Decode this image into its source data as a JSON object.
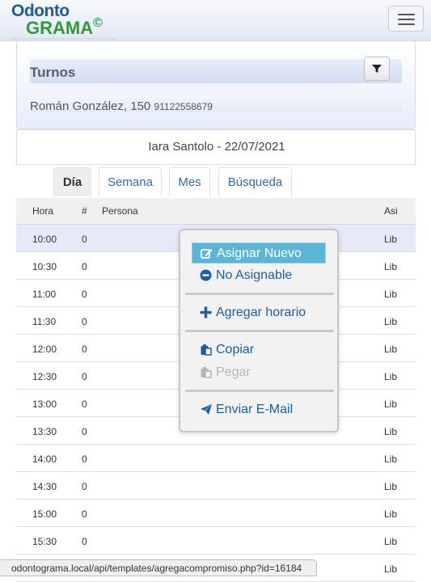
{
  "logo": {
    "line1": "Odonto",
    "line2": "GRAMA",
    "mark": "©"
  },
  "panel": {
    "title": "Turnos",
    "patient_name": "Román González, 150",
    "patient_phone": "91122558679"
  },
  "doctor_date": "Iara Santolo - 22/07/2021",
  "tabs": [
    {
      "label": "Día",
      "active": true
    },
    {
      "label": "Semana",
      "active": false
    },
    {
      "label": "Mes",
      "active": false
    },
    {
      "label": "Búsqueda",
      "active": false
    }
  ],
  "table": {
    "headers": {
      "hora": "Hora",
      "num": "#",
      "persona": "Persona",
      "asi": "Asi"
    },
    "rows": [
      {
        "hora": "10:00",
        "num": "0",
        "persona": "",
        "asi": "Lib"
      },
      {
        "hora": "10:30",
        "num": "0",
        "persona": "",
        "asi": "Lib"
      },
      {
        "hora": "11:00",
        "num": "0",
        "persona": "",
        "asi": "Lib"
      },
      {
        "hora": "11:30",
        "num": "0",
        "persona": "",
        "asi": "Lib"
      },
      {
        "hora": "12:00",
        "num": "0",
        "persona": "",
        "asi": "Lib"
      },
      {
        "hora": "12:30",
        "num": "0",
        "persona": "",
        "asi": "Lib"
      },
      {
        "hora": "13:00",
        "num": "0",
        "persona": "",
        "asi": "Lib"
      },
      {
        "hora": "13:30",
        "num": "0",
        "persona": "",
        "asi": "Lib"
      },
      {
        "hora": "14:00",
        "num": "0",
        "persona": "",
        "asi": "Lib"
      },
      {
        "hora": "14:30",
        "num": "0",
        "persona": "",
        "asi": "Lib"
      },
      {
        "hora": "15:00",
        "num": "0",
        "persona": "",
        "asi": "Lib"
      },
      {
        "hora": "15:30",
        "num": "0",
        "persona": "",
        "asi": "Lib"
      },
      {
        "hora": "",
        "num": "",
        "persona": "",
        "asi": "Lib"
      }
    ]
  },
  "context_menu": {
    "assign_new": "Asignar Nuevo",
    "not_assignable": "No Asignable",
    "add_schedule": "Agregar horario",
    "copy": "Copiar",
    "paste": "Pegar",
    "send_email": "Enviar E-Mail"
  },
  "status_url": "odontograma.local/api/templates/agregacompromiso.php?id=16184",
  "colors": {
    "brand_blue": "#1f5a9a",
    "brand_green": "#2f9a3c",
    "link": "#1c5ea4",
    "highlight": "#5bb5d7"
  }
}
